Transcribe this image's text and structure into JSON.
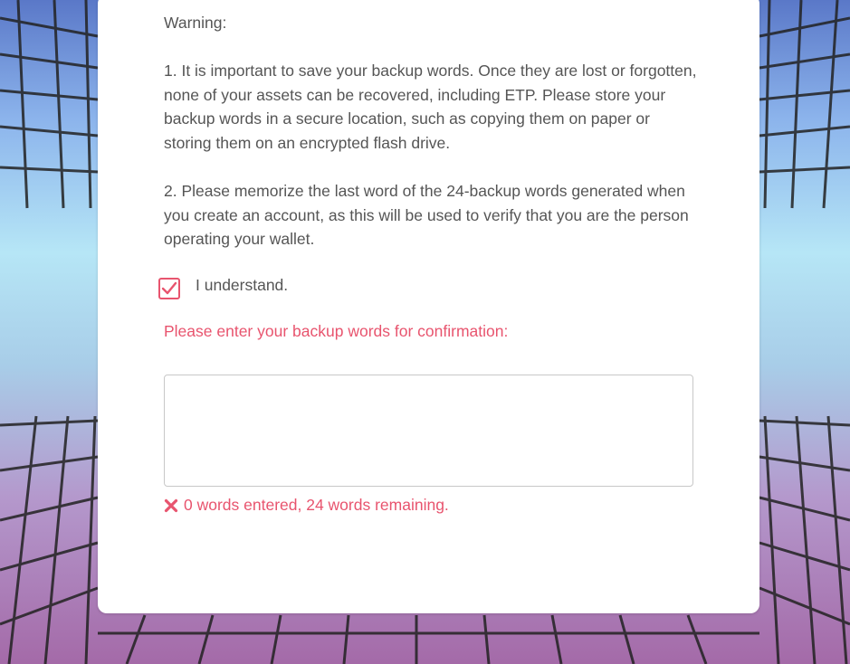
{
  "warning": {
    "heading": "Warning:",
    "point1": "1. It is important to save your backup words. Once they are lost or forgotten, none of your assets can be recovered, including ETP. Please store your backup words in a secure location, such as copying them on paper or storing them on an encrypted flash drive.",
    "point2": "2. Please memorize the last word of the 24-backup words generated when you create an account, as this will be used to verify that you are the person operating your wallet."
  },
  "understand": {
    "label": "I understand.",
    "checked": true
  },
  "backup": {
    "prompt": "Please enter your backup words for confirmation:",
    "value": "",
    "status": "0 words entered, 24 words remaining.",
    "status_icon": "x-icon"
  },
  "colors": {
    "accent": "#e8546e",
    "text": "#555555"
  }
}
